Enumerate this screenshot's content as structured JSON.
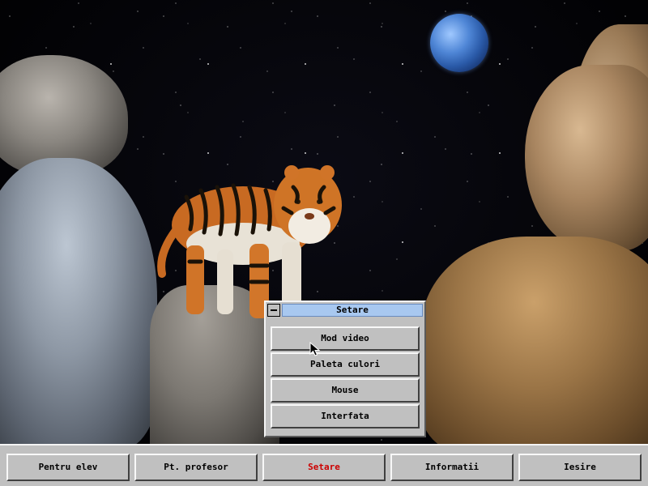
{
  "colors": {
    "active_text": "#cc0000",
    "title_bar": "#a8c8f0",
    "button_face": "#c0c0c0"
  },
  "popup": {
    "title": "Setare",
    "system_icon": "minus-icon",
    "items": [
      {
        "label": "Mod video"
      },
      {
        "label": "Paleta culori"
      },
      {
        "label": "Mouse"
      },
      {
        "label": "Interfata"
      }
    ]
  },
  "taskbar": {
    "buttons": [
      {
        "label": "Pentru elev"
      },
      {
        "label": "Pt. profesor"
      },
      {
        "label": "Setare",
        "active": true
      },
      {
        "label": "Informatii"
      },
      {
        "label": "Iesire"
      }
    ]
  }
}
